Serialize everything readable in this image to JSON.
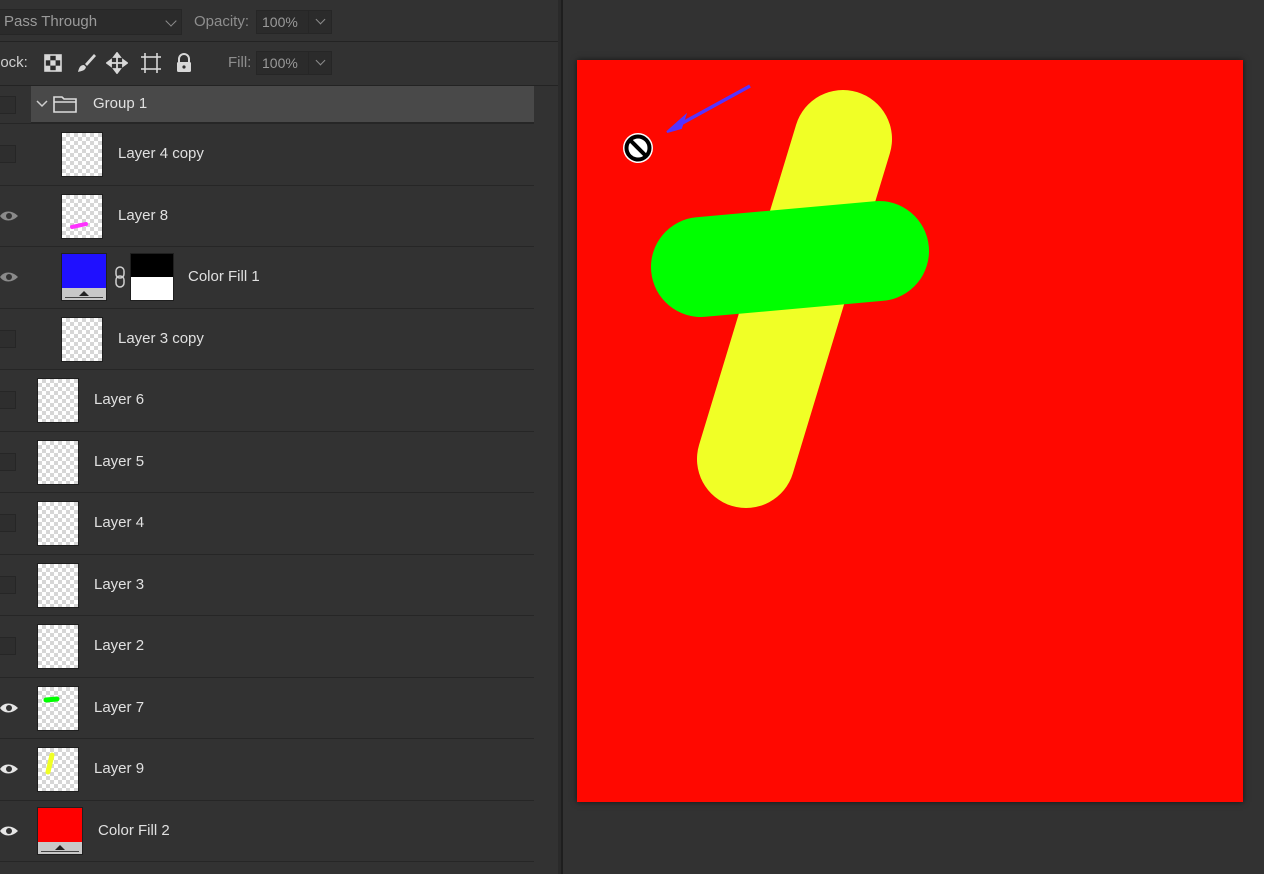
{
  "panel": {
    "blend_mode": "Pass Through",
    "opacity_label": "Opacity:",
    "opacity_value": "100%",
    "lock_label": "Lock:",
    "fill_label": "Fill:",
    "fill_value": "100%"
  },
  "layers": [
    {
      "name": "Group 1",
      "kind": "group",
      "visible": false,
      "expanded": true
    },
    {
      "name": "Layer 4 copy",
      "kind": "pixel",
      "visible": false,
      "in_group": true
    },
    {
      "name": "Layer 8",
      "kind": "pixel",
      "visible": true,
      "in_group": true,
      "stroke_color": "#ff33ff"
    },
    {
      "name": "Color Fill 1",
      "kind": "fill",
      "visible": true,
      "in_group": true,
      "fill_color": "#1f10ff",
      "has_mask": true
    },
    {
      "name": "Layer 3 copy",
      "kind": "pixel",
      "visible": false,
      "in_group": true
    },
    {
      "name": "Layer 6",
      "kind": "pixel",
      "visible": false
    },
    {
      "name": "Layer 5",
      "kind": "pixel",
      "visible": false
    },
    {
      "name": "Layer 4",
      "kind": "pixel",
      "visible": false
    },
    {
      "name": "Layer 3",
      "kind": "pixel",
      "visible": false
    },
    {
      "name": "Layer 2",
      "kind": "pixel",
      "visible": false
    },
    {
      "name": "Layer 7",
      "kind": "pixel",
      "visible": true,
      "stroke_color": "#00ff00"
    },
    {
      "name": "Layer 9",
      "kind": "pixel",
      "visible": true,
      "stroke_color": "#f0ff26"
    },
    {
      "name": "Color Fill 2",
      "kind": "fill",
      "visible": true,
      "fill_color": "#ff0000"
    }
  ],
  "canvas": {
    "background_color": "#ff0800",
    "yellow_stroke_color": "#f0ff26",
    "green_stroke_color": "#00ff00",
    "arrow_color": "#5533ff",
    "cursor_icon": "not-allowed-icon"
  }
}
